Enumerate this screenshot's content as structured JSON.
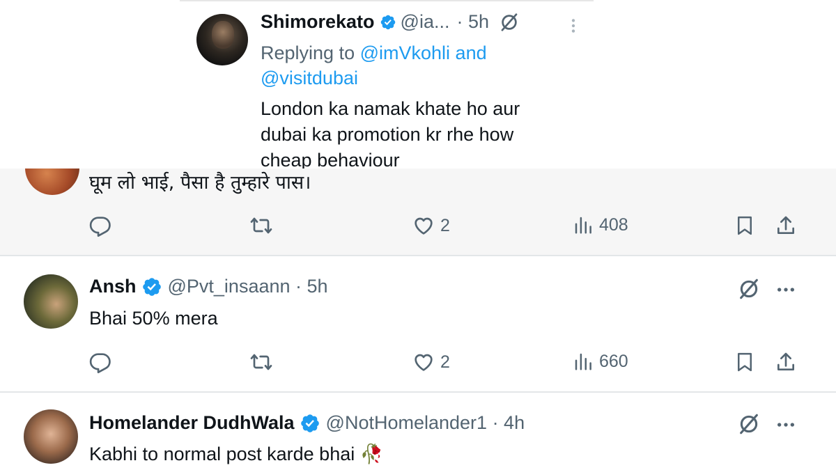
{
  "top_reply": {
    "name": "Shimorekato",
    "handle": "@ia...",
    "time": "· 5h",
    "replying_prefix": "Replying to",
    "replying_to_1": "@imVkohli and",
    "replying_to_2": "@visitdubai",
    "body": "London ka namak khate ho aur dubai ka promotion kr rhe how cheap behaviour"
  },
  "hindi_reply": {
    "body": "घूम लो भाई, पैसा है तुम्हारे पास।",
    "likes": "2",
    "views": "408"
  },
  "tweets": [
    {
      "name": "Ansh",
      "handle_time": "@Pvt_insaann · 5h",
      "body": "Bhai 50% mera",
      "likes": "2",
      "views": "660"
    },
    {
      "name": "Homelander DudhWala",
      "handle_time": "@NotHomelander1 · 4h",
      "body": "Kabhi to normal post karde bhai",
      "emoji": "🥀"
    }
  ],
  "colors": {
    "verified": "#1d9bf0",
    "mention": "#1d9bf0",
    "secondary_text": "#536471",
    "primary_text": "#0f1419"
  },
  "icons": [
    "verified-badge-icon",
    "grok-icon",
    "more-icon",
    "reply-icon",
    "retweet-icon",
    "like-icon",
    "views-icon",
    "bookmark-icon",
    "share-icon"
  ]
}
